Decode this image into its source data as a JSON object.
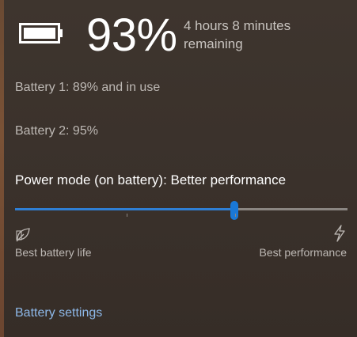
{
  "battery": {
    "percent_text": "93%",
    "remaining_text": "4 hours 8 minutes remaining",
    "icon": "battery-full-icon",
    "level": 0.93
  },
  "batteries": [
    {
      "text": "Battery 1: 89% and in use"
    },
    {
      "text": "Battery 2: 95%"
    }
  ],
  "power_mode": {
    "label": "Power mode (on battery): Better performance",
    "slider_value": 0.66,
    "left_label": "Best battery life",
    "right_label": "Best performance",
    "left_icon": "leaf-icon",
    "right_icon": "lightning-icon"
  },
  "links": {
    "battery_settings": "Battery settings"
  },
  "colors": {
    "accent": "#1a78d6",
    "link": "#8db8e8"
  }
}
